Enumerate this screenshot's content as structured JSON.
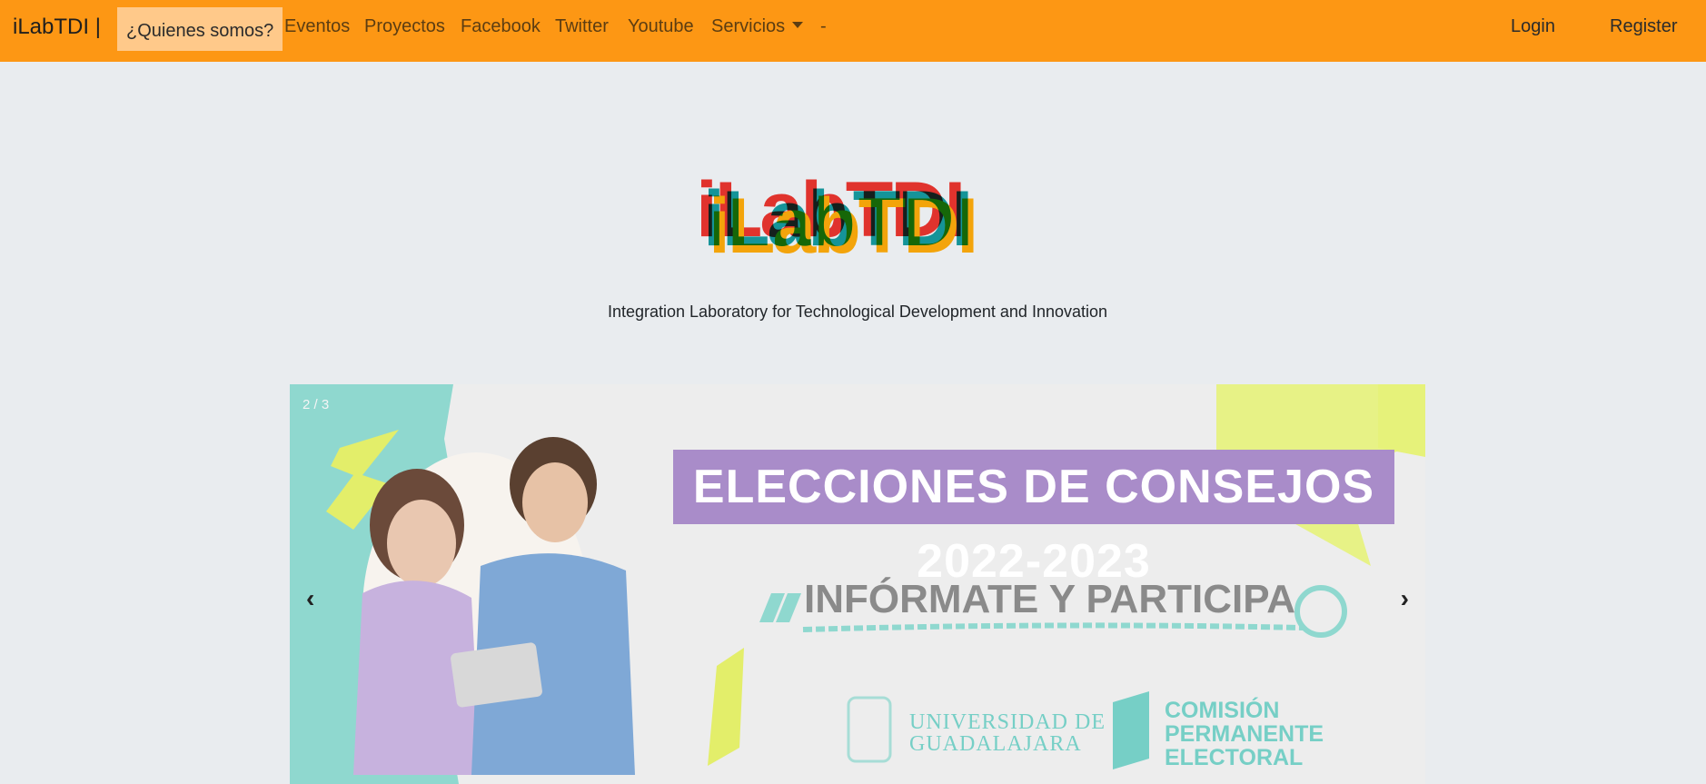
{
  "navbar": {
    "brand": "iLabTDI |",
    "items": [
      {
        "label": "¿Quienes somos?"
      },
      {
        "label": "Eventos"
      },
      {
        "label": "Proyectos"
      },
      {
        "label": "Facebook"
      },
      {
        "label": "Twitter"
      },
      {
        "label": "Youtube"
      },
      {
        "label": "Servicios"
      },
      {
        "label": "-"
      }
    ],
    "login": "Login",
    "register": "Register",
    "accent": "#fd9714"
  },
  "hero": {
    "logo_text": "iLabTDI",
    "tagline": "Integration Laboratory for Technological Development and Innovation"
  },
  "carousel": {
    "counter": "2 / 3",
    "prev_icon": "‹",
    "next_icon": "›",
    "slide": {
      "headline": "ELECCIONES DE CONSEJOS 2022-2023",
      "subheadline": "INFÓRMATE Y PARTICIPA",
      "org_1": "UNIVERSIDAD DE GUADALAJARA",
      "org_2": "COMISIÓN PERMANENTE ELECTORAL"
    }
  }
}
